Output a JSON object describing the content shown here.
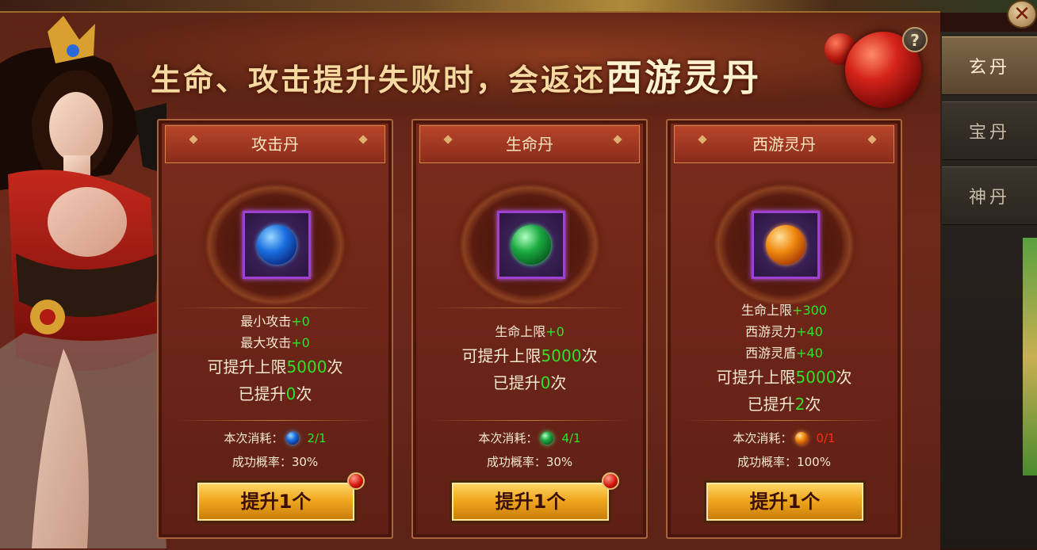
{
  "banner": {
    "headline_prefix": "生命、攻击提升失败时，会返还",
    "headline_highlight": "西游灵丹"
  },
  "buttons": {
    "help": "?",
    "close": "✕"
  },
  "tabs": [
    {
      "label": "玄丹",
      "active": true
    },
    {
      "label": "宝丹",
      "active": false
    },
    {
      "label": "神丹",
      "active": false
    }
  ],
  "cards": [
    {
      "title": "攻击丹",
      "gem": "blue",
      "stats": [
        {
          "label": "最小攻击",
          "value": "+0"
        },
        {
          "label": "最大攻击",
          "value": "+0"
        }
      ],
      "limit_prefix": "可提升上限",
      "limit_value": "5000",
      "limit_suffix": "次",
      "done_prefix": "已提升",
      "done_value": "0",
      "done_suffix": "次",
      "cost_label": "本次消耗：",
      "cost_value": "2/1",
      "cost_ok": true,
      "rate_label": "成功概率：",
      "rate_value": "30%",
      "button": "提升1个",
      "badge": true
    },
    {
      "title": "生命丹",
      "gem": "green",
      "stats": [
        {
          "label": "生命上限",
          "value": "+0"
        }
      ],
      "limit_prefix": "可提升上限",
      "limit_value": "5000",
      "limit_suffix": "次",
      "done_prefix": "已提升",
      "done_value": "0",
      "done_suffix": "次",
      "cost_label": "本次消耗：",
      "cost_value": "4/1",
      "cost_ok": true,
      "rate_label": "成功概率：",
      "rate_value": "30%",
      "button": "提升1个",
      "badge": true
    },
    {
      "title": "西游灵丹",
      "gem": "orange",
      "stats": [
        {
          "label": "生命上限",
          "value": "+300"
        },
        {
          "label": "西游灵力",
          "value": "+40"
        },
        {
          "label": "西游灵盾",
          "value": "+40"
        }
      ],
      "limit_prefix": "可提升上限",
      "limit_value": "5000",
      "limit_suffix": "次",
      "done_prefix": "已提升",
      "done_value": "2",
      "done_suffix": "次",
      "cost_label": "本次消耗：",
      "cost_value": "0/1",
      "cost_ok": false,
      "rate_label": "成功概率：",
      "rate_value": "100%",
      "button": "提升1个",
      "badge": false
    }
  ]
}
